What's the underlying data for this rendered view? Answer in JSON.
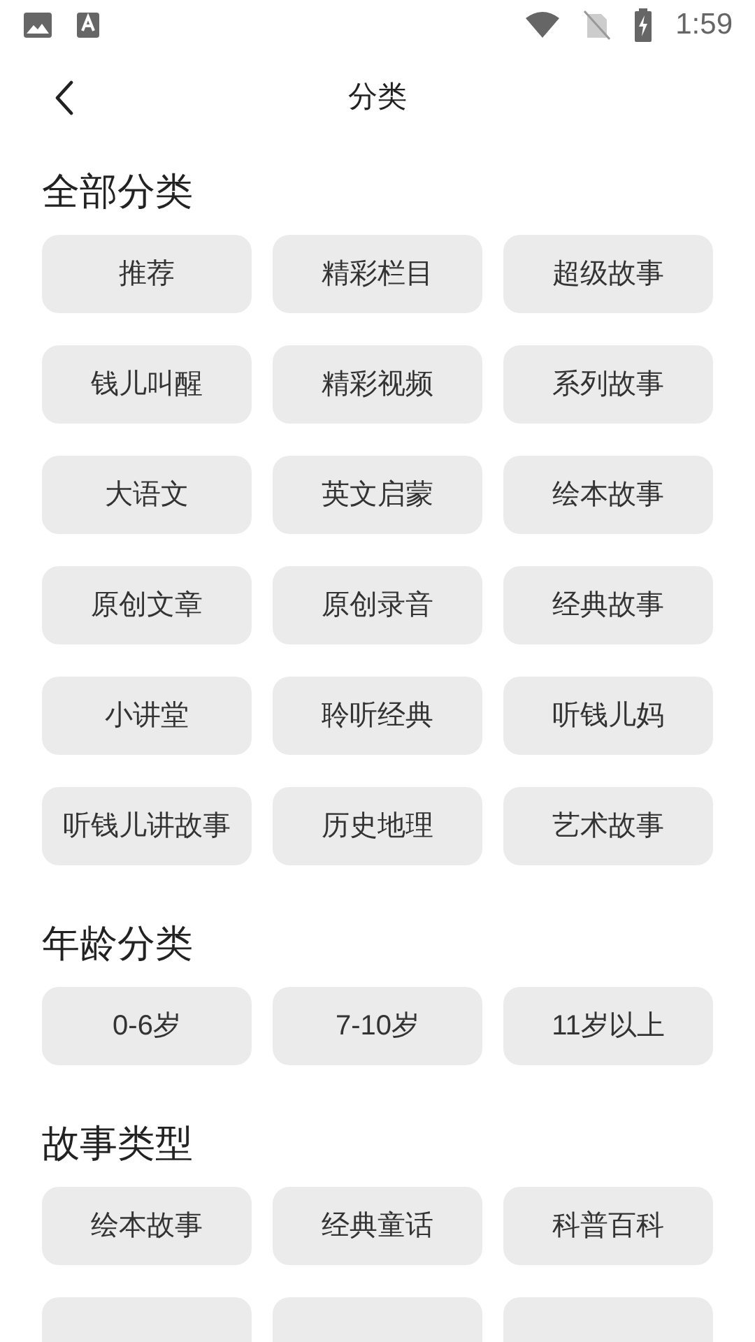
{
  "status_bar": {
    "time": "1:59"
  },
  "header": {
    "title": "分类"
  },
  "sections": [
    {
      "title": "全部分类",
      "items": [
        "推荐",
        "精彩栏目",
        "超级故事",
        "钱儿叫醒",
        "精彩视频",
        "系列故事",
        "大语文",
        "英文启蒙",
        "绘本故事",
        "原创文章",
        "原创录音",
        "经典故事",
        "小讲堂",
        "聆听经典",
        "听钱儿妈",
        "听钱儿讲故事",
        "历史地理",
        "艺术故事"
      ]
    },
    {
      "title": "年龄分类",
      "items": [
        "0-6岁",
        "7-10岁",
        "11岁以上"
      ]
    },
    {
      "title": "故事类型",
      "items": [
        "绘本故事",
        "经典童话",
        "科普百科"
      ],
      "cut_off_items": [
        {
          "kind": "chip"
        },
        {
          "kind": "chip"
        },
        {
          "kind": "chip"
        }
      ]
    }
  ]
}
